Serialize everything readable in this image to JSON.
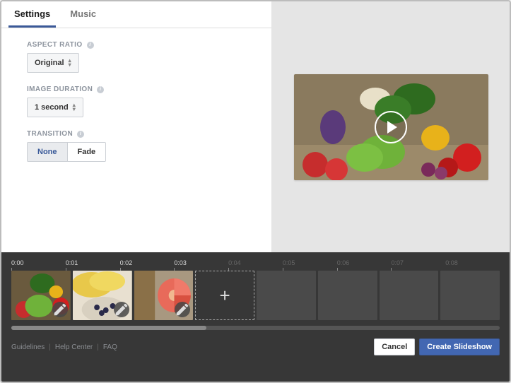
{
  "tabs": {
    "settings": "Settings",
    "music": "Music"
  },
  "aspect_ratio": {
    "label": "ASPECT RATIO",
    "value": "Original"
  },
  "image_duration": {
    "label": "IMAGE DURATION",
    "value": "1 second"
  },
  "transition": {
    "label": "TRANSITION",
    "none": "None",
    "fade": "Fade"
  },
  "timeline": {
    "ticks": [
      "0:00",
      "0:01",
      "0:02",
      "0:03",
      "0:04",
      "0:05",
      "0:06",
      "0:07",
      "0:08"
    ],
    "add": "+"
  },
  "footer": {
    "guidelines": "Guidelines",
    "help": "Help Center",
    "faq": "FAQ",
    "cancel": "Cancel",
    "create": "Create Slideshow"
  }
}
